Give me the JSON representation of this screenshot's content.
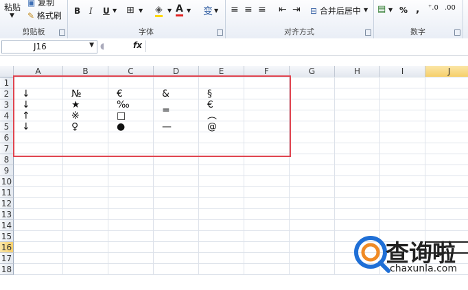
{
  "ribbon": {
    "clipboard": {
      "paste": "粘贴",
      "copy": "复制",
      "format_painter": "格式刷",
      "label": "剪贴板"
    },
    "font": {
      "label": "字体",
      "bold": "B",
      "italic": "I",
      "underline": "U",
      "font_color": "A",
      "wen": "变"
    },
    "alignment": {
      "label": "对齐方式",
      "merge_center": "合并后居中"
    },
    "number": {
      "label": "数字",
      "percent": "%",
      "comma": ","
    }
  },
  "formula_bar": {
    "name_box": "J16",
    "fx": "fx",
    "formula": ""
  },
  "grid": {
    "columns": [
      "A",
      "B",
      "C",
      "D",
      "E",
      "F",
      "G",
      "H",
      "I",
      "J"
    ],
    "rows": [
      "1",
      "2",
      "3",
      "4",
      "5",
      "6",
      "7",
      "8",
      "9",
      "10",
      "11",
      "12",
      "13",
      "14",
      "15",
      "16",
      "17",
      "18"
    ],
    "selected_column": "J",
    "selected_row": "16"
  },
  "cells": {
    "A2": "↓",
    "A3": "↓",
    "A4": "↑",
    "A5": "↓",
    "B2": "№",
    "B3": "★",
    "B4": "※",
    "B5": "♀",
    "C2": "€",
    "C3": "‰",
    "C4": "□",
    "C5": "●",
    "D2": "&",
    "D3": "=",
    "D5": "—",
    "E2": "§",
    "E3": "€",
    "E4": "︵",
    "E5": "@"
  },
  "watermark": {
    "brand": "查询啦",
    "site": "chaxunla.com"
  },
  "colors": {
    "highlight_box": "#e0444f",
    "selected_header": "#f6cf6b",
    "watermark_blue": "#1f6fd6"
  }
}
